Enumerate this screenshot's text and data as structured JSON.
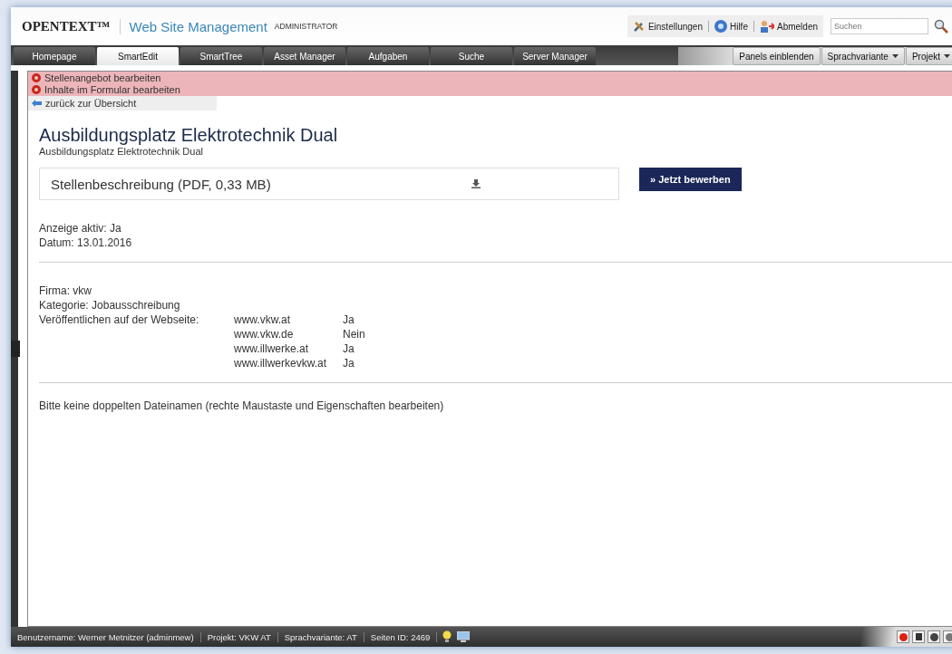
{
  "header": {
    "brand": "OPENTEXT™",
    "product": "Web Site Management",
    "role": "ADMINISTRATOR",
    "links": [
      {
        "kind": "settings",
        "label": "Einstellungen"
      },
      {
        "kind": "help",
        "label": "Hilfe"
      },
      {
        "kind": "logout",
        "label": "Abmelden"
      }
    ],
    "search": {
      "placeholder": "Suchen"
    }
  },
  "tabs": [
    {
      "label": "Homepage",
      "selected": false
    },
    {
      "label": "SmartEdit",
      "selected": true
    },
    {
      "label": "SmartTree",
      "selected": false
    },
    {
      "label": "Asset Manager",
      "selected": false
    },
    {
      "label": "Aufgaben",
      "selected": false
    },
    {
      "label": "Suche",
      "selected": false
    },
    {
      "label": "Server Manager",
      "selected": false
    }
  ],
  "tools": [
    {
      "label": "Panels einblenden",
      "dropdown": false
    },
    {
      "label": "Sprachvariante",
      "dropdown": true
    },
    {
      "label": "Projekt",
      "dropdown": true
    }
  ],
  "edit_bar": {
    "items": [
      "Stellenangebot bearbeiten",
      "Inhalte im Formular bearbeiten"
    ],
    "back": "zurück zur Übersicht"
  },
  "page": {
    "title": "Ausbildungsplatz Elektrotechnik Dual",
    "subtitle": "Ausbildungsplatz Elektrotechnik Dual",
    "download": "Stellenbeschreibung (PDF, 0,33 MB)",
    "apply": "» Jetzt bewerben",
    "meta": [
      "Anzeige aktiv: Ja",
      "Datum: 13.01.2016"
    ],
    "details": [
      "Firma: vkw",
      "Kategorie: Jobausschreibung"
    ],
    "publish_label": "Veröffentlichen auf der Webseite:",
    "sites": [
      {
        "site": "www.vkw.at",
        "value": "Ja"
      },
      {
        "site": "www.vkw.de",
        "value": "Nein"
      },
      {
        "site": "www.illwerke.at",
        "value": "Ja"
      },
      {
        "site": "www.illwerkevkw.at",
        "value": "Ja"
      }
    ],
    "note": "Bitte keine doppelten Dateinamen (rechte Maustaste und Eigenschaften bearbeiten)"
  },
  "status_bar": [
    "Benutzername: Werner Metnitzer (adminmew)",
    "Projekt: VKW AT",
    "Sprachvariante: AT",
    "Seiten ID: 2469"
  ]
}
